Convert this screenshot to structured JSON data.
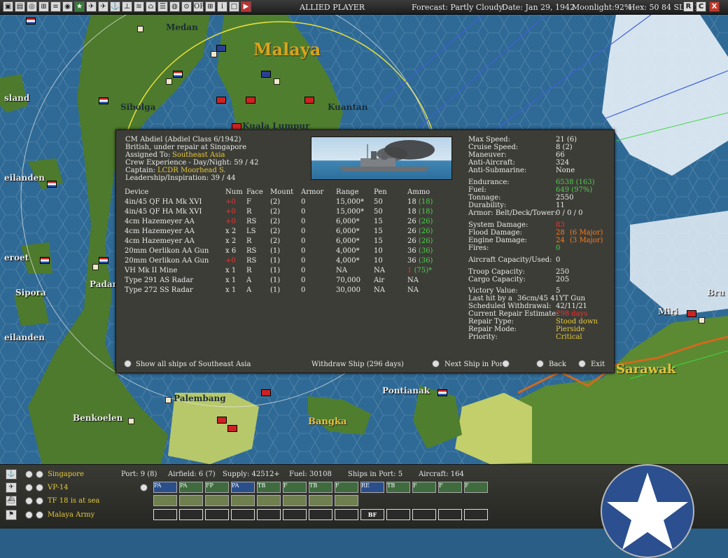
{
  "topbar": {
    "side": "ALLIED PLAYER",
    "forecast": "Forecast: Partly Cloudy",
    "date": "Date: Jan 29, 1942",
    "moonlight": "Moonlight:92%",
    "hex": "Hex: 50 84  SL: 21",
    "buttons": [
      "R",
      "C",
      "X"
    ]
  },
  "map": {
    "labels": {
      "medan": "Medan",
      "malaya": "Malaya",
      "island": "sland",
      "sibolga": "Sibolga",
      "kuantan": "Kuantan",
      "kuala_lumpur": "Kuala Lumpur",
      "eilanden1": "eilanden",
      "eilanden2": "eilanden",
      "eroet": "eroet",
      "sipora": "Sipora",
      "padang": "Padan",
      "bru": "Bru",
      "miri": "Miri",
      "sarawak": "Sarawak",
      "pontianak": "Pontianak",
      "palembang": "Palembang",
      "benkoelen": "Benkoelen",
      "bangka": "Bangka"
    }
  },
  "ship": {
    "line1": "CM Abdiel (Abdiel Class 6/1942)",
    "line2": "British, under repair at Singapore",
    "assigned_label": "Assigned To:",
    "assigned_value": "Southeast Asia",
    "crew": "Crew Experience - Day/Night: 59 / 42",
    "captain_label": "Captain:",
    "captain_value": "LCDR Moorhead S.",
    "leadership": "Leadership/Inspiration: 39 / 44"
  },
  "devices": {
    "headers": [
      "Device",
      "Num",
      "Face",
      "Mount",
      "Armor",
      "Range",
      "Pen",
      "Ammo"
    ],
    "rows": [
      {
        "device": "4in/45 QF HA Mk XVI",
        "num": "+0",
        "face": "F",
        "mount": "(2)",
        "armor": "0",
        "range": "15,000*",
        "pen": "50",
        "ammo": "18",
        "ammo2": "(18)"
      },
      {
        "device": "4in/45 QF HA Mk XVI",
        "num": "+0",
        "face": "R",
        "mount": "(2)",
        "armor": "0",
        "range": "15,000*",
        "pen": "50",
        "ammo": "18",
        "ammo2": "(18)"
      },
      {
        "device": "4cm Hazemeyer AA",
        "num": "+0",
        "face": "RS",
        "mount": "(2)",
        "armor": "0",
        "range": "6,000*",
        "pen": "15",
        "ammo": "26",
        "ammo2": "(26)"
      },
      {
        "device": "4cm Hazemeyer AA",
        "num": "x 2",
        "face": "LS",
        "mount": "(2)",
        "armor": "0",
        "range": "6,000*",
        "pen": "15",
        "ammo": "26",
        "ammo2": "(26)"
      },
      {
        "device": "4cm Hazemeyer AA",
        "num": "x 2",
        "face": "R",
        "mount": "(2)",
        "armor": "0",
        "range": "6,000*",
        "pen": "15",
        "ammo": "26",
        "ammo2": "(26)"
      },
      {
        "device": "20mm Oerlikon AA Gun",
        "num": "x 6",
        "face": "RS",
        "mount": "(1)",
        "armor": "0",
        "range": "4,000*",
        "pen": "10",
        "ammo": "36",
        "ammo2": "(36)"
      },
      {
        "device": "20mm Oerlikon AA Gun",
        "num": "+0",
        "face": "RS",
        "mount": "(1)",
        "armor": "0",
        "range": "4,000*",
        "pen": "10",
        "ammo": "36",
        "ammo2": "(36)"
      },
      {
        "device": "VH Mk II Mine",
        "num": "x 1",
        "face": "R",
        "mount": "(1)",
        "armor": "0",
        "range": "NA",
        "pen": "NA",
        "ammo": "1",
        "ammo2": "(75)*"
      },
      {
        "device": "Type 291 AS Radar",
        "num": "x 1",
        "face": "A",
        "mount": "(1)",
        "armor": "0",
        "range": "70,000",
        "pen": "Air",
        "ammo": "NA",
        "ammo2": ""
      },
      {
        "device": "Type 272 SS Radar",
        "num": "x 1",
        "face": "A",
        "mount": "(1)",
        "armor": "0",
        "range": "30,000",
        "pen": "NA",
        "ammo": "NA",
        "ammo2": ""
      }
    ]
  },
  "stats": {
    "max_speed_l": "Max Speed:",
    "max_speed_v": "21 (6)",
    "cruise_l": "Cruise Speed:",
    "cruise_v": "8 (2)",
    "maneuver_l": "Maneuver:",
    "maneuver_v": "66",
    "aa_l": "Anti-Aircraft:",
    "aa_v": "324",
    "as_l": "Anti-Submarine:",
    "as_v": "None",
    "endurance_l": "Endurance:",
    "endurance_v": "6538 (163)",
    "fuel_l": "Fuel:",
    "fuel_v": "649 (97%)",
    "tonnage_l": "Tonnage:",
    "tonnage_v": "2550",
    "durability_l": "Durability:",
    "durability_v": "11",
    "armor_l": "Armor: Belt/Deck/Tower:",
    "armor_v": "0 / 0 / 0",
    "sysdmg_l": "System Damage:",
    "sysdmg_v": "83",
    "flooddmg_l": "Flood Damage:",
    "flooddmg_v": "28",
    "flooddmg_x": "(6 Major)",
    "enginedmg_l": "Engine Damage:",
    "enginedmg_v": "24",
    "enginedmg_x": "(3 Major)",
    "fires_l": "Fires:",
    "fires_v": "0",
    "aircap_l": "Aircraft Capacity/Used:",
    "aircap_v": "0",
    "troop_l": "Troop Capacity:",
    "troop_v": "250",
    "cargo_l": "Cargo Capacity:",
    "cargo_v": "205",
    "vp_l": "Victory Value:",
    "vp_v": "5",
    "lasthit_l": "Last hit by a",
    "lasthit_v": "36cm/45 41YT Gun",
    "withdraw_l": "Scheduled Withdrawal:",
    "withdraw_v": "42/11/21",
    "repairest_l": "Current Repair Estimate:",
    "repairest_v": "298 days",
    "repairtype_l": "Repair Type:",
    "repairtype_v": "Stood down",
    "repairmode_l": "Repair Mode:",
    "repairmode_v": "Pierside",
    "priority_l": "Priority:",
    "priority_v": "Critical"
  },
  "panel_footer": {
    "show_all": "Show all ships of Southeast Asia",
    "withdraw": "Withdraw Ship (296 days)",
    "next_ship": "Next Ship in Port",
    "back": "Back",
    "exit": "Exit"
  },
  "bottom": {
    "rows": [
      {
        "name": "Singapore",
        "icon": "anchor-icon"
      },
      {
        "name": "VP-14",
        "icon": "plane-icon"
      },
      {
        "name": "TF 18 is at sea",
        "icon": "ship-icon"
      },
      {
        "name": "Malaya Army",
        "icon": "flag-icon"
      }
    ],
    "port": "Port: 9 (8)",
    "airfield": "Airfield: 6 (7)",
    "supply": "Supply: 42512+",
    "fuel": "Fuel: 30108",
    "ships_in_port": "Ships in Port: 5",
    "aircraft": "Aircraft: 164",
    "air_slots": [
      "PA",
      "PA",
      "FP",
      "PA",
      "TB",
      "F",
      "TB",
      "F",
      "RE",
      "TB",
      "F",
      "F"
    ],
    "land_slots": [
      "BF"
    ]
  },
  "colors": {
    "panel_bg": "#3d3d37",
    "yellow_text": "#e5c93a",
    "green_text": "#4cd04c",
    "red_text": "#e33",
    "orange_text": "#ff7a1a",
    "sea": "#2a5e86",
    "land": "#4f7a2e"
  }
}
